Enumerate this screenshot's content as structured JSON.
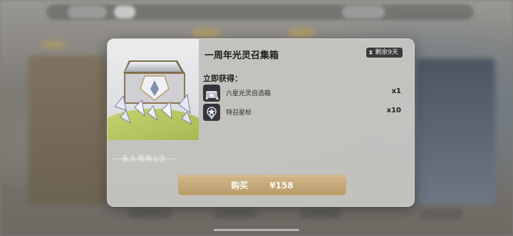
{
  "popup": {
    "title": "一周年光灵召集箱",
    "timer": {
      "icon": "hourglass-icon",
      "text": "剩余9天"
    },
    "art_caption": "永久限购1次",
    "section_label": "立即获得：",
    "rewards": [
      {
        "icon": "chest-icon",
        "name": "六星光灵自选箱",
        "qty": "x1"
      },
      {
        "icon": "star-badge-icon",
        "name": "特召星标",
        "qty": "x10"
      }
    ],
    "buy_button": {
      "label": "购买",
      "price": "¥158"
    }
  },
  "colors": {
    "popup_bg": "#c8c7c4",
    "button_gold": "#c8ac7c",
    "badge_dark": "#3a3a3a"
  }
}
